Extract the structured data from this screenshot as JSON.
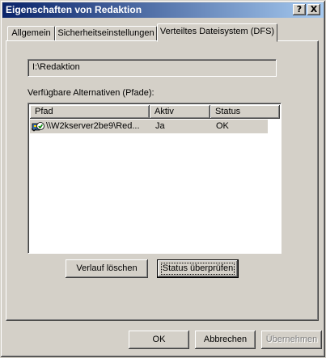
{
  "window": {
    "title": "Eigenschaften von Redaktion",
    "help_button": "?",
    "close_button": "X"
  },
  "tabs": [
    {
      "label": "Allgemein",
      "active": false
    },
    {
      "label": "Sicherheitseinstellungen",
      "active": false
    },
    {
      "label": "Verteiltes Dateisystem (DFS)",
      "active": true
    }
  ],
  "dfs": {
    "path_value": "I:\\Redaktion",
    "alternatives_label": "Verfügbare Alternativen (Pfade):",
    "columns": [
      "Pfad",
      "Aktiv",
      "Status"
    ],
    "rows": [
      {
        "pfad": "\\\\W2kserver2be9\\Red...",
        "aktiv": "Ja",
        "status": "OK",
        "icon": "shared-folder-check-icon"
      }
    ],
    "clear_history_button": "Verlauf löschen",
    "check_status_button": "Status überprüfen"
  },
  "footer": {
    "ok": "OK",
    "cancel": "Abbrechen",
    "apply": "Übernehmen",
    "apply_enabled": false
  },
  "colors": {
    "titlebar_start": "#0a246a",
    "titlebar_end": "#a6caf0",
    "face": "#d4d0c8"
  }
}
